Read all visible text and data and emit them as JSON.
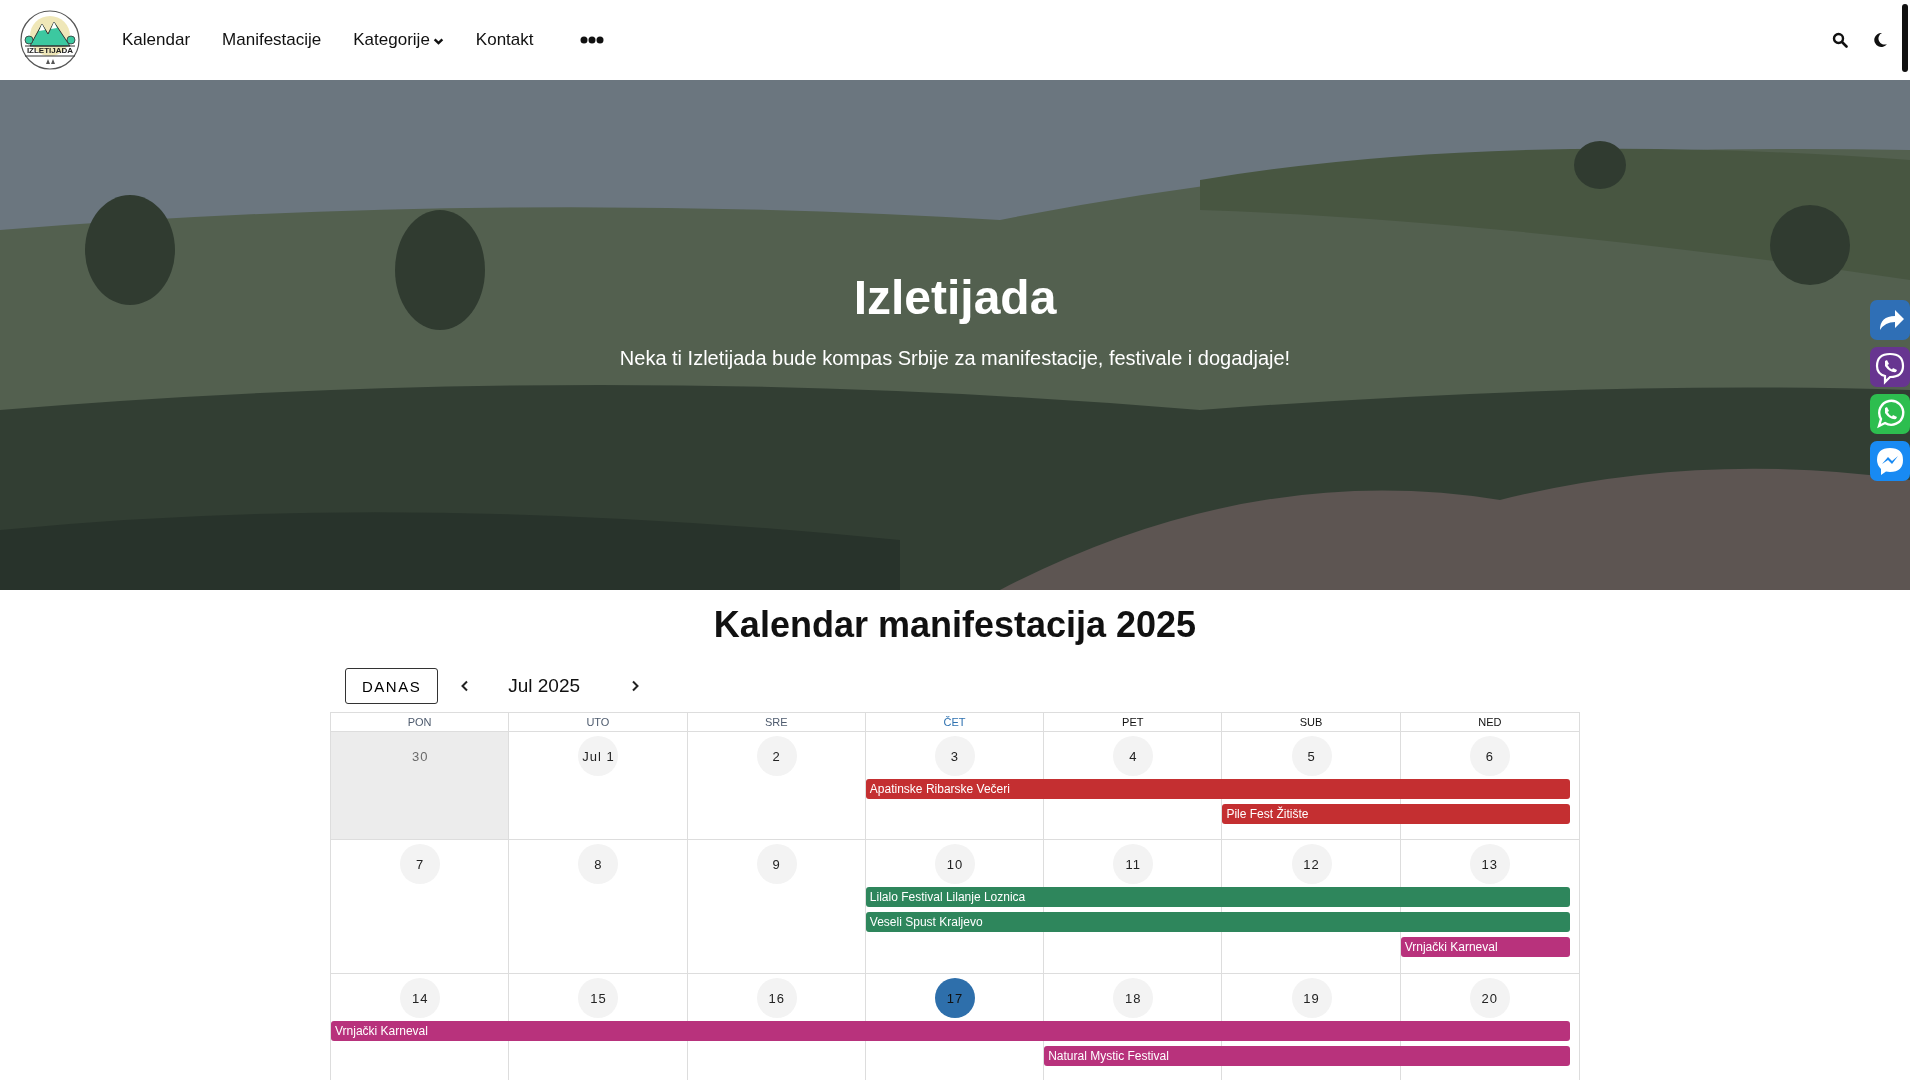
{
  "header": {
    "logo_text": "IZLETIJADA",
    "nav": [
      {
        "label": "Kalendar",
        "kind": "link"
      },
      {
        "label": "Manifestacije",
        "kind": "link"
      },
      {
        "label": "Kategorije",
        "kind": "dropdown"
      },
      {
        "label": "Kontakt",
        "kind": "link"
      }
    ]
  },
  "hero": {
    "title": "Izletijada",
    "subtitle": "Neka ti Izletijada bude kompas Srbije za manifestacije, festivale i dogadjaje!"
  },
  "share": [
    {
      "kind": "share"
    },
    {
      "kind": "viber"
    },
    {
      "kind": "whatsapp"
    },
    {
      "kind": "messenger"
    }
  ],
  "calendar": {
    "title": "Kalendar manifestacija 2025",
    "today_button": "DANAS",
    "month": "Jul 2025",
    "weekdays": [
      {
        "label": "PON",
        "kind": "past"
      },
      {
        "label": "UTO",
        "kind": "past"
      },
      {
        "label": "SRE",
        "kind": "past"
      },
      {
        "label": "ČET",
        "kind": "today"
      },
      {
        "label": "PET",
        "kind": "future"
      },
      {
        "label": "SUB",
        "kind": "future"
      },
      {
        "label": "NED",
        "kind": "future"
      }
    ],
    "weeks": [
      {
        "days": [
          {
            "label": "30",
            "outside": true,
            "today": false
          },
          {
            "label": "Jul 1",
            "outside": false,
            "today": false
          },
          {
            "label": "2",
            "outside": false,
            "today": false
          },
          {
            "label": "3",
            "outside": false,
            "today": false
          },
          {
            "label": "4",
            "outside": false,
            "today": false
          },
          {
            "label": "5",
            "outside": false,
            "today": false
          },
          {
            "label": "6",
            "outside": false,
            "today": false
          }
        ],
        "lanes": [
          {
            "slots": [
              {
                "kind": "empty"
              },
              {
                "kind": "empty"
              },
              {
                "kind": "empty"
              },
              {
                "kind": "start",
                "title": "Apatinske Ribarske Večeri",
                "color": "#c42f31"
              },
              {
                "kind": "continue"
              },
              {
                "kind": "continue"
              },
              {
                "kind": "continue"
              }
            ]
          },
          {
            "slots": [
              {
                "kind": "empty"
              },
              {
                "kind": "empty"
              },
              {
                "kind": "empty"
              },
              {
                "kind": "empty"
              },
              {
                "kind": "empty"
              },
              {
                "kind": "start",
                "title": "Pile Fest Žitište",
                "color": "#c42f31"
              },
              {
                "kind": "continue"
              }
            ]
          }
        ]
      },
      {
        "days": [
          {
            "label": "7",
            "outside": false,
            "today": false
          },
          {
            "label": "8",
            "outside": false,
            "today": false
          },
          {
            "label": "9",
            "outside": false,
            "today": false
          },
          {
            "label": "10",
            "outside": false,
            "today": false
          },
          {
            "label": "11",
            "outside": false,
            "today": false
          },
          {
            "label": "12",
            "outside": false,
            "today": false
          },
          {
            "label": "13",
            "outside": false,
            "today": false
          }
        ],
        "lanes": [
          {
            "slots": [
              {
                "kind": "empty"
              },
              {
                "kind": "empty"
              },
              {
                "kind": "empty"
              },
              {
                "kind": "start",
                "title": "Lilalo Festival Lilanje Loznica",
                "color": "#2e865c"
              },
              {
                "kind": "continue"
              },
              {
                "kind": "continue"
              },
              {
                "kind": "continue"
              }
            ]
          },
          {
            "slots": [
              {
                "kind": "empty"
              },
              {
                "kind": "empty"
              },
              {
                "kind": "empty"
              },
              {
                "kind": "start",
                "title": "Veseli Spust Kraljevo",
                "color": "#2e865c"
              },
              {
                "kind": "continue"
              },
              {
                "kind": "continue"
              },
              {
                "kind": "continue"
              }
            ]
          },
          {
            "slots": [
              {
                "kind": "empty"
              },
              {
                "kind": "empty"
              },
              {
                "kind": "empty"
              },
              {
                "kind": "empty"
              },
              {
                "kind": "empty"
              },
              {
                "kind": "empty"
              },
              {
                "kind": "start",
                "title": "Vrnjački Karneval",
                "color": "#b8327c"
              }
            ]
          }
        ]
      },
      {
        "days": [
          {
            "label": "14",
            "outside": false,
            "today": false
          },
          {
            "label": "15",
            "outside": false,
            "today": false
          },
          {
            "label": "16",
            "outside": false,
            "today": false
          },
          {
            "label": "17",
            "outside": false,
            "today": true
          },
          {
            "label": "18",
            "outside": false,
            "today": false
          },
          {
            "label": "19",
            "outside": false,
            "today": false
          },
          {
            "label": "20",
            "outside": false,
            "today": false
          }
        ],
        "lanes": [
          {
            "slots": [
              {
                "kind": "start",
                "title": "Vrnjački Karneval",
                "color": "#b8327c"
              },
              {
                "kind": "continue"
              },
              {
                "kind": "continue"
              },
              {
                "kind": "continue"
              },
              {
                "kind": "continue"
              },
              {
                "kind": "continue"
              },
              {
                "kind": "continue"
              }
            ]
          },
          {
            "slots": [
              {
                "kind": "empty"
              },
              {
                "kind": "empty"
              },
              {
                "kind": "empty"
              },
              {
                "kind": "empty"
              },
              {
                "kind": "start",
                "title": "Natural Mystic Festival",
                "color": "#b8327c"
              },
              {
                "kind": "continue"
              },
              {
                "kind": "continue"
              }
            ]
          }
        ]
      }
    ]
  }
}
